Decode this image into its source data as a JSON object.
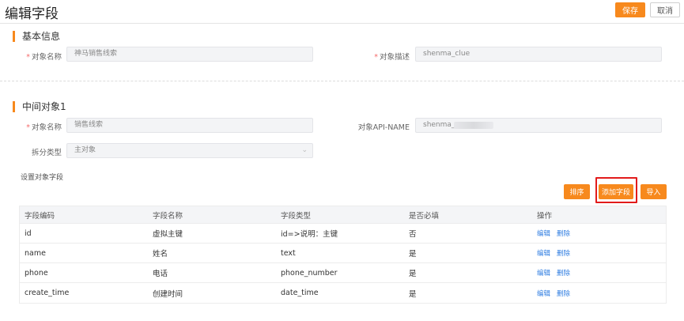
{
  "header": {
    "title": "编辑字段",
    "save_label": "保存",
    "cancel_label": "取消"
  },
  "basic": {
    "section_title": "基本信息",
    "name_label": "对象名称",
    "name_value": "神马销售线索",
    "desc_label": "对象描述",
    "desc_value": "shenma_clue"
  },
  "middle": {
    "section_title": "中间对象1",
    "name_label": "对象名称",
    "name_value": "销售线索",
    "api_label": "对象API-NAME",
    "api_value": "shenma_",
    "split_label": "拆分类型",
    "split_value": "主对象",
    "set_fields_label": "设置对象字段",
    "sort_label": "排序",
    "add_field_label": "添加字段",
    "import_label": "导入"
  },
  "table": {
    "columns": [
      "字段编码",
      "字段名称",
      "字段类型",
      "是否必填",
      "操作"
    ],
    "rows": [
      {
        "code": "id",
        "name": "虚拟主键",
        "type": "id=>说明：主键",
        "required": "否"
      },
      {
        "code": "name",
        "name": "姓名",
        "type": "text",
        "required": "是"
      },
      {
        "code": "phone",
        "name": "电话",
        "type": "phone_number",
        "required": "是"
      },
      {
        "code": "create_time",
        "name": "创建时间",
        "type": "date_time",
        "required": "是"
      }
    ],
    "edit_label": "编辑",
    "delete_label": "删除"
  },
  "colors": {
    "accent": "#f7891d",
    "highlight": "#e21b1b",
    "link": "#2f7de1"
  }
}
